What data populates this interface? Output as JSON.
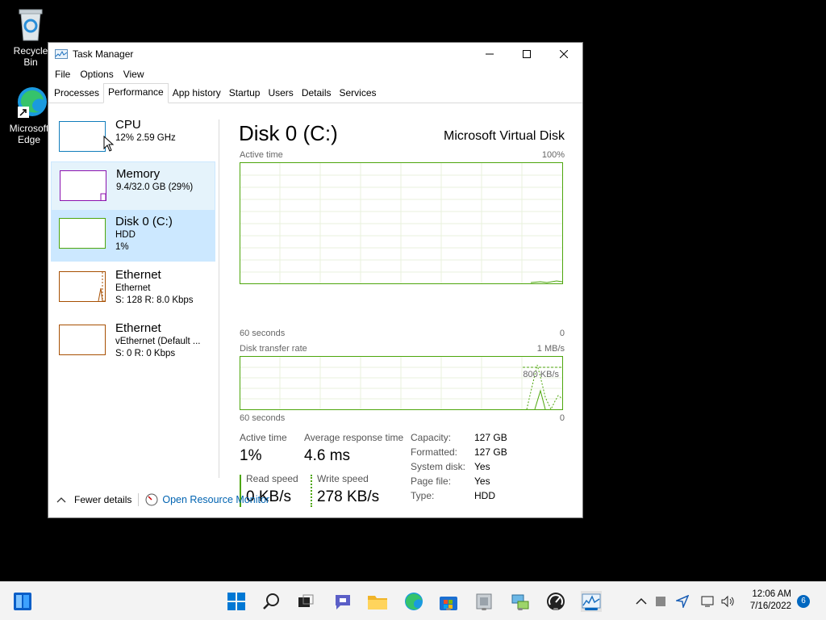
{
  "desktop": {
    "icons": [
      {
        "label": "Recycle Bin",
        "icon": "recycle-bin-icon"
      },
      {
        "label": "Microsoft Edge",
        "icon": "edge-icon"
      }
    ]
  },
  "window": {
    "title": "Task Manager",
    "menu": [
      "File",
      "Options",
      "View"
    ],
    "tabs": [
      "Processes",
      "Performance",
      "App history",
      "Startup",
      "Users",
      "Details",
      "Services"
    ],
    "active_tab": "Performance"
  },
  "sidebar": {
    "items": [
      {
        "title": "CPU",
        "line1": "12%  2.59 GHz",
        "line2": "",
        "color": "#117dbb",
        "state": "hover-cursor"
      },
      {
        "title": "Memory",
        "line1": "9.4/32.0 GB (29%)",
        "line2": "",
        "color": "#8b12ae",
        "state": "hover"
      },
      {
        "title": "Disk 0 (C:)",
        "line1": "HDD",
        "line2": "1%",
        "color": "#4da60c",
        "state": "selected"
      },
      {
        "title": "Ethernet",
        "line1": "Ethernet",
        "line2": "S: 128  R: 8.0 Kbps",
        "color": "#a74f01",
        "state": "normal"
      },
      {
        "title": "Ethernet",
        "line1": "vEthernet (Default ...",
        "line2": "S: 0  R: 0 Kbps",
        "color": "#a74f01",
        "state": "normal"
      }
    ]
  },
  "disk": {
    "heading": "Disk 0 (C:)",
    "model": "Microsoft Virtual Disk",
    "graph1": {
      "label": "Active time",
      "max": "100%",
      "xlabel": "60 seconds",
      "min": "0"
    },
    "graph2": {
      "label": "Disk transfer rate",
      "max": "1 MB/s",
      "marker": "800 KB/s",
      "xlabel": "60 seconds",
      "min": "0"
    },
    "stats": {
      "active_time_label": "Active time",
      "active_time_value": "1%",
      "response_label": "Average response time",
      "response_value": "4.6 ms",
      "read_label": "Read speed",
      "read_value": "0 KB/s",
      "write_label": "Write speed",
      "write_value": "278 KB/s"
    },
    "details": [
      {
        "label": "Capacity:",
        "value": "127 GB"
      },
      {
        "label": "Formatted:",
        "value": "127 GB"
      },
      {
        "label": "System disk:",
        "value": "Yes"
      },
      {
        "label": "Page file:",
        "value": "Yes"
      },
      {
        "label": "Type:",
        "value": "HDD"
      }
    ]
  },
  "footer": {
    "fewer_details": "Fewer details",
    "open_resource_monitor": "Open Resource Monitor"
  },
  "taskbar": {
    "icons": [
      "widgets-icon",
      "start-icon",
      "search-icon",
      "task-view-icon",
      "chat-icon",
      "file-explorer-icon",
      "edge-icon",
      "store-icon",
      "app-icon",
      "network-app-icon",
      "gauge-app-icon",
      "task-manager-icon"
    ],
    "time": "12:06 AM",
    "date": "7/16/2022",
    "notification_count": "6"
  }
}
